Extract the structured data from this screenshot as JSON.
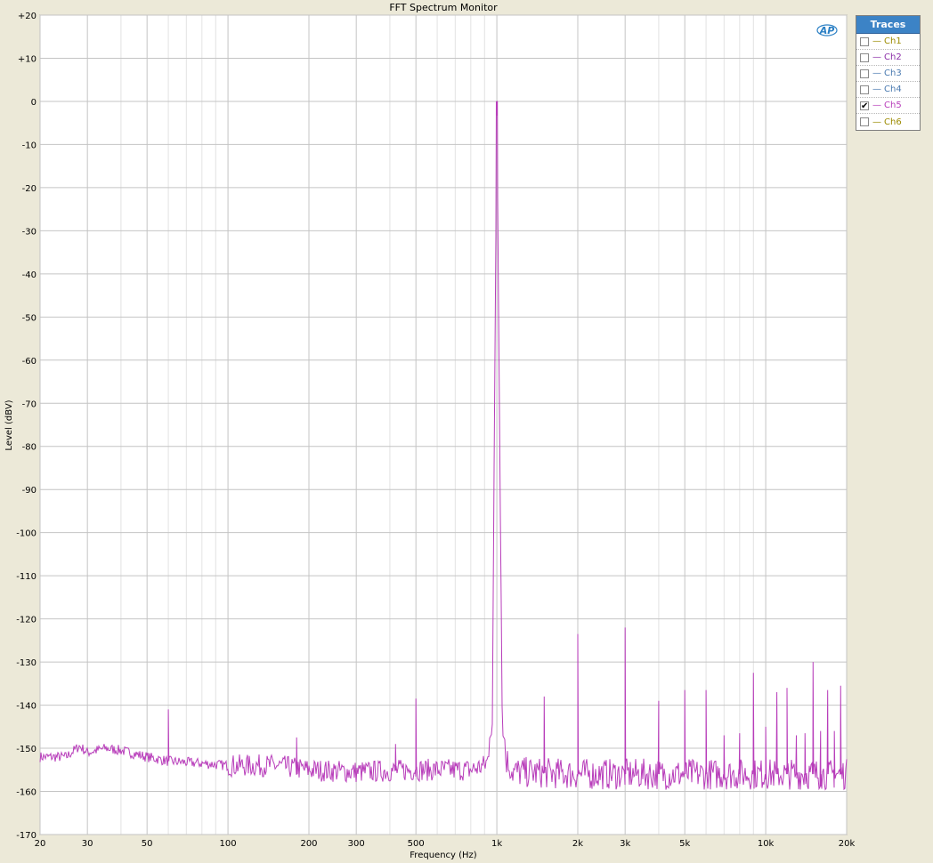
{
  "chart_data": {
    "type": "line",
    "title": "FFT Spectrum Monitor",
    "xlabel": "Frequency (Hz)",
    "ylabel": "Level (dBV)",
    "xscale": "log",
    "xlim": [
      20,
      20000
    ],
    "ylim": [
      -170,
      20
    ],
    "grid": true,
    "x_ticks": [
      {
        "value": 20,
        "label": "20"
      },
      {
        "value": 30,
        "label": "30"
      },
      {
        "value": 50,
        "label": "50"
      },
      {
        "value": 100,
        "label": "100"
      },
      {
        "value": 200,
        "label": "200"
      },
      {
        "value": 300,
        "label": "300"
      },
      {
        "value": 500,
        "label": "500"
      },
      {
        "value": 1000,
        "label": "1k"
      },
      {
        "value": 2000,
        "label": "2k"
      },
      {
        "value": 3000,
        "label": "3k"
      },
      {
        "value": 5000,
        "label": "5k"
      },
      {
        "value": 10000,
        "label": "10k"
      },
      {
        "value": 20000,
        "label": "20k"
      }
    ],
    "y_ticks": [
      {
        "value": 20,
        "label": "+20"
      },
      {
        "value": 10,
        "label": "+10"
      },
      {
        "value": 0,
        "label": "0"
      },
      {
        "value": -10,
        "label": "-10"
      },
      {
        "value": -20,
        "label": "-20"
      },
      {
        "value": -30,
        "label": "-30"
      },
      {
        "value": -40,
        "label": "-40"
      },
      {
        "value": -50,
        "label": "-50"
      },
      {
        "value": -60,
        "label": "-60"
      },
      {
        "value": -70,
        "label": "-70"
      },
      {
        "value": -80,
        "label": "-80"
      },
      {
        "value": -90,
        "label": "-90"
      },
      {
        "value": -100,
        "label": "-100"
      },
      {
        "value": -110,
        "label": "-110"
      },
      {
        "value": -120,
        "label": "-120"
      },
      {
        "value": -130,
        "label": "-130"
      },
      {
        "value": -140,
        "label": "-140"
      },
      {
        "value": -150,
        "label": "-150"
      },
      {
        "value": -160,
        "label": "-160"
      },
      {
        "value": -170,
        "label": "-170"
      }
    ],
    "series": [
      {
        "name": "Ch5",
        "color": "#b83dba",
        "noise_floor_points": [
          [
            20,
            -152
          ],
          [
            25,
            -152
          ],
          [
            28,
            -149.5
          ],
          [
            30,
            -151
          ],
          [
            35,
            -150
          ],
          [
            40,
            -150.5
          ],
          [
            50,
            -152
          ],
          [
            60,
            -153
          ],
          [
            80,
            -153.5
          ],
          [
            100,
            -154
          ],
          [
            150,
            -154
          ],
          [
            200,
            -155
          ],
          [
            300,
            -155.5
          ],
          [
            500,
            -155
          ],
          [
            800,
            -155
          ],
          [
            900,
            -154
          ],
          [
            960,
            -151
          ],
          [
            1000,
            0
          ],
          [
            1050,
            -151
          ],
          [
            1150,
            -155.5
          ],
          [
            2000,
            -156
          ],
          [
            5000,
            -156
          ],
          [
            10000,
            -156
          ],
          [
            20000,
            -156
          ]
        ],
        "peaks": [
          {
            "x": 60,
            "y": -141
          },
          {
            "x": 180,
            "y": -147.5
          },
          {
            "x": 420,
            "y": -149
          },
          {
            "x": 500,
            "y": -138.5
          },
          {
            "x": 1000,
            "y": 0
          },
          {
            "x": 1500,
            "y": -138
          },
          {
            "x": 2000,
            "y": -123.5
          },
          {
            "x": 3000,
            "y": -122
          },
          {
            "x": 4000,
            "y": -139
          },
          {
            "x": 5000,
            "y": -136.5
          },
          {
            "x": 6000,
            "y": -136.5
          },
          {
            "x": 7000,
            "y": -147
          },
          {
            "x": 8000,
            "y": -146.5
          },
          {
            "x": 9000,
            "y": -132.5
          },
          {
            "x": 10000,
            "y": -145
          },
          {
            "x": 11000,
            "y": -137
          },
          {
            "x": 12000,
            "y": -136
          },
          {
            "x": 13000,
            "y": -147
          },
          {
            "x": 14000,
            "y": -146.5
          },
          {
            "x": 15000,
            "y": -130
          },
          {
            "x": 16000,
            "y": -146
          },
          {
            "x": 17000,
            "y": -136.5
          },
          {
            "x": 18000,
            "y": -146
          },
          {
            "x": 19000,
            "y": -135.5
          }
        ]
      }
    ]
  },
  "legend": {
    "title": "Traces",
    "items": [
      {
        "label": "Ch1",
        "checked": false,
        "color": "#9c8b00"
      },
      {
        "label": "Ch2",
        "checked": false,
        "color": "#8c2fa8"
      },
      {
        "label": "Ch3",
        "checked": false,
        "color": "#4a7ab0"
      },
      {
        "label": "Ch4",
        "checked": false,
        "color": "#4a7ab0"
      },
      {
        "label": "Ch5",
        "checked": true,
        "color": "#b83dba"
      },
      {
        "label": "Ch6",
        "checked": false,
        "color": "#9c8b00"
      }
    ]
  },
  "logo": {
    "text": "AP",
    "color": "#2a7fc4"
  }
}
